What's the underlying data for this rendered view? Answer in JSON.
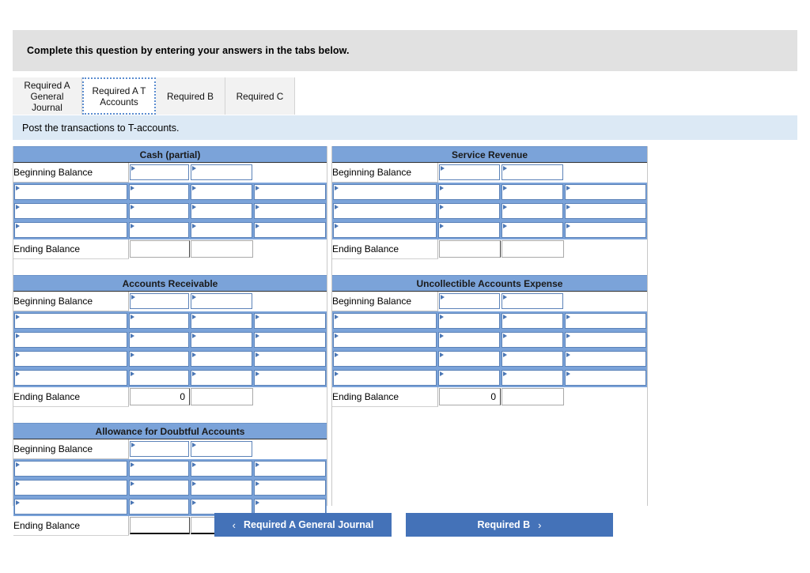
{
  "header": {
    "instruction": "Complete this question by entering your answers in the tabs below."
  },
  "tabs": [
    {
      "label": "Required A\nGeneral\nJournal",
      "active": false
    },
    {
      "label": "Required A T\nAccounts",
      "active": true
    },
    {
      "label": "Required B",
      "active": false
    },
    {
      "label": "Required C",
      "active": false
    }
  ],
  "banner": {
    "text": "Post the transactions to T-accounts."
  },
  "labels": {
    "beginning_balance": "Beginning Balance",
    "ending_balance": "Ending Balance"
  },
  "accounts": {
    "cash": {
      "title": "Cash (partial)",
      "txn_rows": 3,
      "ending_debit": "",
      "ending_credit": "",
      "ruled": false
    },
    "accounts_receivable": {
      "title": "Accounts Receivable",
      "txn_rows": 4,
      "ending_debit": "0",
      "ending_credit": "",
      "ruled": false
    },
    "allowance": {
      "title": "Allowance for Doubtful Accounts",
      "txn_rows": 3,
      "ending_debit": "",
      "ending_credit": "",
      "ruled": true
    },
    "service_revenue": {
      "title": "Service Revenue",
      "txn_rows": 3,
      "ending_debit": "",
      "ending_credit": "",
      "ruled": false
    },
    "uncollectible_expense": {
      "title": "Uncollectible Accounts Expense",
      "txn_rows": 4,
      "ending_debit": "0",
      "ending_credit": "",
      "ruled": false
    }
  },
  "footer": {
    "prev_label": "Required A General Journal",
    "prev_chevron": "‹",
    "next_label": "Required B",
    "next_chevron": "›"
  },
  "colors": {
    "account_header_blue": "#7ba3d9",
    "button_blue": "#4472b8",
    "banner_blue": "#dce9f5",
    "gray_header": "#e1e1e1"
  }
}
